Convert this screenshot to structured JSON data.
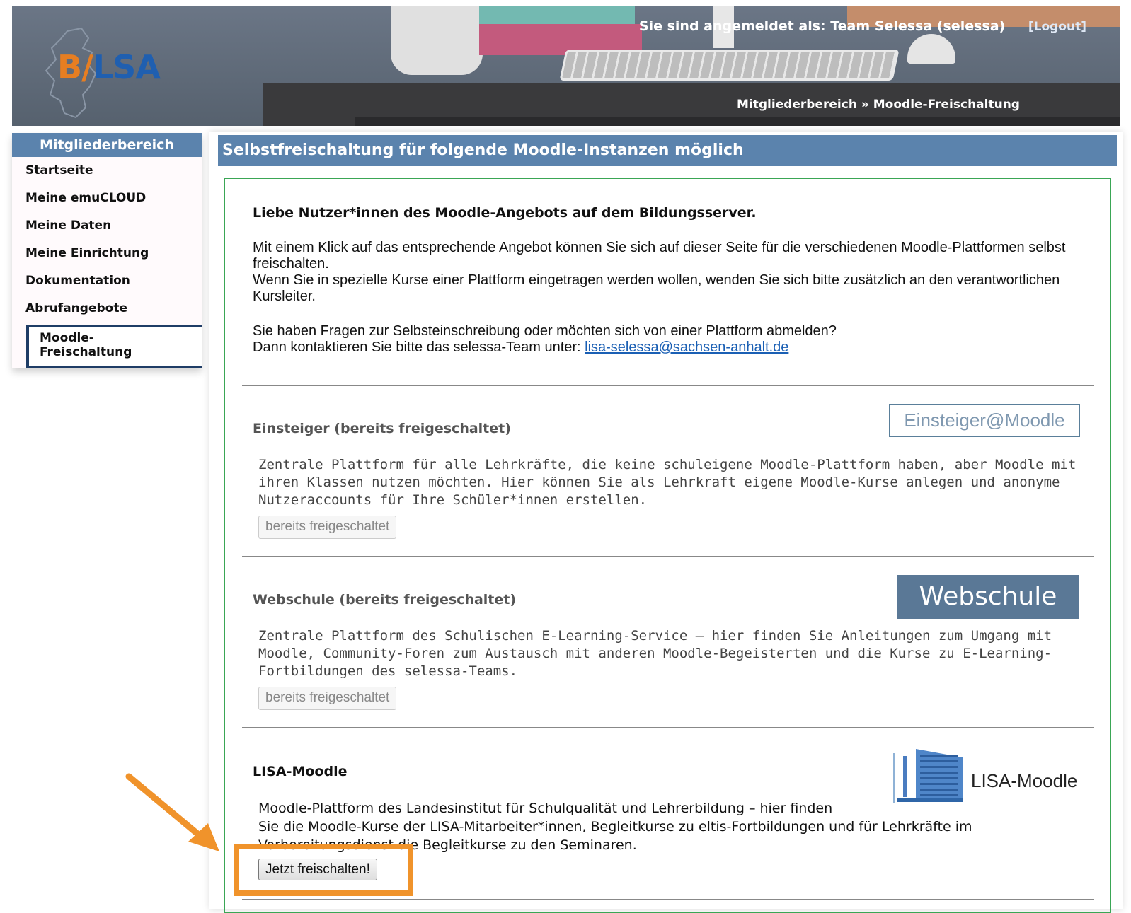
{
  "header": {
    "logo_text_b": "B",
    "logo_text_sep": "/",
    "logo_text_lsa": "LSA",
    "login_text": "Sie sind angemeldet als: Team Selessa (selessa)",
    "logout_label": "[Logout]",
    "breadcrumb": "Mitgliederbereich » Moodle-Freischaltung"
  },
  "sidebar": {
    "title": "Mitgliederbereich",
    "items": [
      {
        "label": "Startseite"
      },
      {
        "label": "Meine emuCLOUD"
      },
      {
        "label": "Meine Daten"
      },
      {
        "label": "Meine Einrichtung"
      },
      {
        "label": "Dokumentation"
      },
      {
        "label": "Abrufangebote"
      }
    ],
    "active_sub_line1": "Moodle-",
    "active_sub_line2": "Freischaltung"
  },
  "main": {
    "title": "Selbstfreischaltung für folgende Moodle-Instanzen möglich",
    "intro_heading": "Liebe Nutzer*innen des Moodle-Angebots auf dem Bildungsserver.",
    "intro_p1_a": "Mit einem Klick auf das entsprechende Angebot können Sie sich auf dieser Seite für die verschiedenen Moodle-Plattformen selbst freischalten.",
    "intro_p1_b": "Wenn Sie in spezielle Kurse einer Plattform eingetragen werden wollen, wenden Sie sich bitte zusätzlich an den verantwortlichen Kursleiter.",
    "intro_p2_a": "Sie haben Fragen zur Selbsteinschreibung oder möchten sich von einer Plattform abmelden?",
    "intro_p2_b": "Dann kontaktieren Sie bitte das selessa-Team unter: ",
    "contact_email": "lisa-selessa@sachsen-anhalt.de"
  },
  "offers": [
    {
      "title": "Einsteiger (bereits freigeschaltet)",
      "logo_text": "Einsteiger@Moodle",
      "description": "Zentrale Plattform für alle Lehrkräfte, die keine schuleigene Moodle-Plattform haben, aber Moodle mit ihren Klassen nutzen möchten. Hier können Sie als Lehrkraft eigene Moodle-Kurse anlegen und anonyme Nutzeraccounts für Ihre Schüler*innen erstellen.",
      "button_label": "bereits freigeschaltet"
    },
    {
      "title": "Webschule (bereits freigeschaltet)",
      "logo_text": "Webschule",
      "description": "Zentrale Plattform des Schulischen E-Learning-Service – hier finden Sie Anleitungen zum Umgang mit Moodle, Community-Foren zum Austausch mit anderen Moodle-Begeisterten und die Kurse zu E-Learning-Fortbildungen des selessa-Teams.",
      "button_label": "bereits freigeschaltet"
    },
    {
      "title": "LISA-Moodle",
      "logo_text": "LISA-Moodle",
      "description_line1": "Moodle-Plattform des Landesinstitut für Schulqualität und Lehrerbildung – hier finden",
      "description_line2": "Sie die Moodle-Kurse der LISA-Mitarbeiter*innen, Begleitkurse zu eltis-Fortbildungen und für Lehrkräfte im",
      "description_line3": "Vorbereitungsdienst die Begleitkurse zu den Seminaren.",
      "button_label": "Jetzt freischalten!"
    }
  ],
  "colors": {
    "accent_blue": "#5b83ad",
    "content_border_green": "#3aa655",
    "annotation_orange": "#f0932b"
  }
}
